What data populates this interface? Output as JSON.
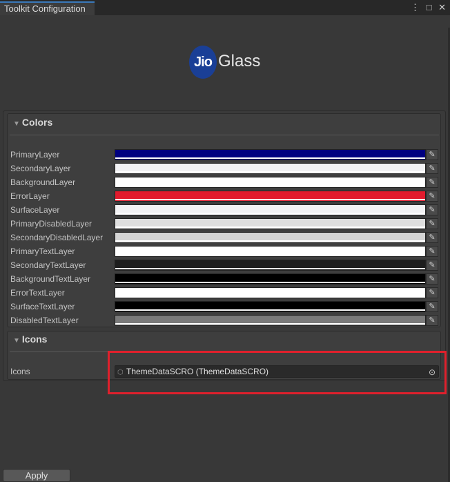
{
  "window": {
    "tab_title": "Toolkit Configuration",
    "menu_icon": "kebab-menu-icon",
    "maximize_icon": "maximize-icon",
    "close_icon": "close-icon"
  },
  "logo": {
    "badge": "Jio",
    "text": "Glass"
  },
  "colors_section": {
    "title": "Colors",
    "rows": [
      {
        "label": "PrimaryLayer",
        "color": "#000080"
      },
      {
        "label": "SecondaryLayer",
        "color": "#f2f2f4"
      },
      {
        "label": "BackgroundLayer",
        "color": "#ffffff"
      },
      {
        "label": "ErrorLayer",
        "color": "#e11b2d"
      },
      {
        "label": "SurfaceLayer",
        "color": "#f2f2f4"
      },
      {
        "label": "PrimaryDisabledLayer",
        "color": "#dedede"
      },
      {
        "label": "SecondaryDisabledLayer",
        "color": "#d4d4d4"
      },
      {
        "label": "PrimaryTextLayer",
        "color": "#ffffff"
      },
      {
        "label": "SecondaryTextLayer",
        "color": "#1e1e1e"
      },
      {
        "label": "BackgroundTextLayer",
        "color": "#000000"
      },
      {
        "label": "ErrorTextLayer",
        "color": "#ffffff"
      },
      {
        "label": "SurfaceTextLayer",
        "color": "#000000"
      },
      {
        "label": "DisabledTextLayer",
        "color": "#7a7a7a"
      }
    ]
  },
  "icons_section": {
    "title": "Icons",
    "field_label": "Icons",
    "field_value": "ThemeDataSCRO (ThemeDataSCRO)"
  },
  "footer": {
    "apply_label": "Apply"
  }
}
